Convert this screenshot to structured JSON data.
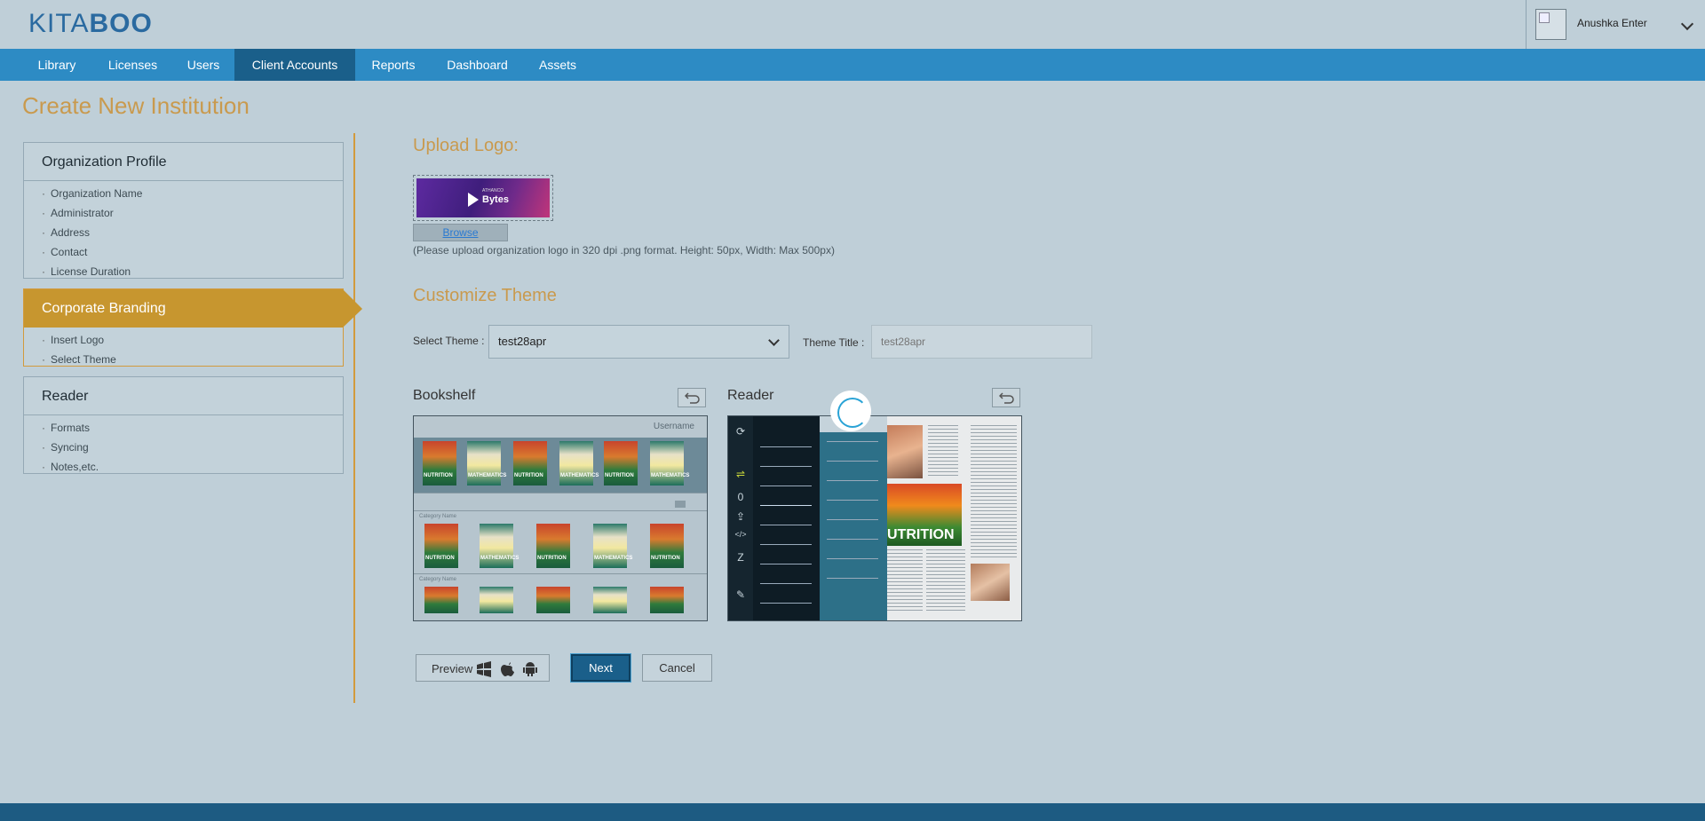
{
  "header": {
    "logo_text_a": "KITA",
    "logo_text_b": "BOO",
    "user_name": "Anushka Enter"
  },
  "nav": {
    "items": [
      {
        "label": "Library",
        "active": false
      },
      {
        "label": "Licenses",
        "active": false
      },
      {
        "label": "Users",
        "active": false
      },
      {
        "label": "Client Accounts",
        "active": true
      },
      {
        "label": "Reports",
        "active": false
      },
      {
        "label": "Dashboard",
        "active": false
      },
      {
        "label": "Assets",
        "active": false
      }
    ]
  },
  "page": {
    "title": "Create New Institution"
  },
  "sidebar": {
    "sections": [
      {
        "title": "Organization Profile",
        "items": [
          "Organization Name",
          "Administrator",
          "Address",
          "Contact",
          "License Duration"
        ]
      },
      {
        "title": "Corporate Branding",
        "items": [
          "Insert Logo",
          "Select Theme"
        ]
      },
      {
        "title": "Reader",
        "items": [
          "Formats",
          "Syncing",
          "Notes,etc."
        ]
      }
    ]
  },
  "upload": {
    "title": "Upload Logo:",
    "logo_brand": "Bytes",
    "logo_small": "ATHANCO",
    "browse_label": "Browse",
    "hint": "(Please upload organization logo in 320 dpi .png format. Height: 50px, Width: Max 500px)"
  },
  "theme": {
    "title": "Customize Theme",
    "select_label": "Select Theme :",
    "selected": "test28apr",
    "title_label": "Theme Title :",
    "title_placeholder": "test28apr"
  },
  "previews": {
    "bookshelf_title": "Bookshelf",
    "bookshelf_username": "Username",
    "bookshelf_category": "Category Name",
    "reader_title": "Reader",
    "book_nutrition": "NUTRITION",
    "book_math": "MATHEMATICS",
    "reader_nutrition": "UTRITION"
  },
  "actions": {
    "preview_label": "Preview",
    "next_label": "Next",
    "cancel_label": "Cancel"
  },
  "colors": {
    "nav_bg": "#2d8bc4",
    "nav_active": "#1a5f8a",
    "accent_gold": "#c7962f",
    "page_bg": "#bfcfd8"
  }
}
